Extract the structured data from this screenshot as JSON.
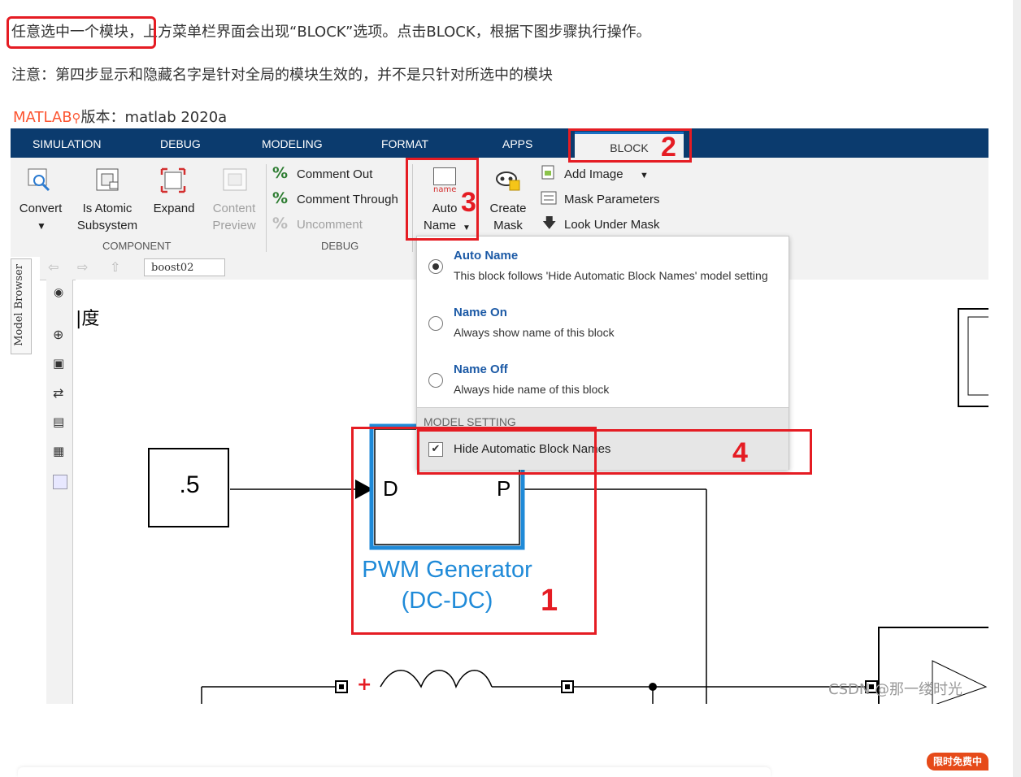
{
  "article": {
    "line1_highlight": "任意选中一个模块，",
    "line1_rest": "上方菜单栏界面会出现“BLOCK”选项。点击BLOCK，根据下图步骤执行操作。",
    "line2": "注意：第四步显示和隐藏名字是针对全局的模块生效的，并不是只针对所选中的模块",
    "line3_link": "MATLAB",
    "line3_rest": "版本：matlab 2020a"
  },
  "menubar": {
    "tabs": [
      "SIMULATION",
      "DEBUG",
      "MODELING",
      "FORMAT",
      "APPS"
    ],
    "active_tab": "BLOCK"
  },
  "ribbon": {
    "convert": "Convert",
    "is_atomic_1": "Is Atomic",
    "is_atomic_2": "Subsystem",
    "expand": "Expand",
    "content_preview_1": "Content",
    "content_preview_2": "Preview",
    "component_group": "COMPONENT",
    "comment_out": "Comment Out",
    "comment_through": "Comment Through",
    "uncomment": "Uncomment",
    "debug_group": "DEBUG",
    "auto_name_icon": "name",
    "auto_name_1": "Auto",
    "auto_name_2": "Name",
    "create_mask_1": "Create",
    "create_mask_2": "Mask",
    "add_image": "Add Image",
    "mask_parameters": "Mask Parameters",
    "look_under_mask": "Look Under Mask"
  },
  "model_browser": "Model Browser",
  "address": "boost02",
  "dropdown": {
    "options": [
      {
        "title": "Auto Name",
        "desc": "This block follows 'Hide Automatic Block Names' model setting",
        "selected": true
      },
      {
        "title": "Name On",
        "desc": "Always show name of this block",
        "selected": false
      },
      {
        "title": "Name Off",
        "desc": "Always hide name of this block",
        "selected": false
      }
    ],
    "model_setting": "MODEL SETTING",
    "hide_auto_names": "Hide Automatic Block Names",
    "hide_checked": true
  },
  "diagram": {
    "constant_value": ".5",
    "port_d": "D",
    "port_p": "P",
    "block_name_1": "PWM Generator",
    "block_name_2": "(DC-DC)",
    "partial_text": "|度",
    "plus_sign": "+",
    "watermark": "CSDN @那一缕时光"
  },
  "annotations": {
    "n1": "1",
    "n2": "2",
    "n3": "3",
    "n4": "4"
  },
  "badge": "限时免费中",
  "colors": {
    "menubar": "#0b3b6e",
    "annotation_red": "#e51c23",
    "block_blue": "#1f8ad8",
    "link_orange": "#fc5531"
  }
}
